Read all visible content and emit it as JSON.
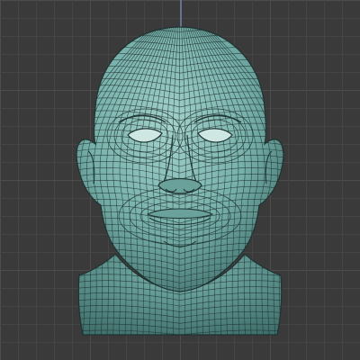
{
  "viewport": {
    "kind": "3d-viewport",
    "object": "wireframe-head-mesh",
    "background_color": "#3a3a3a",
    "grid_minor_color": "#454545",
    "grid_major_color": "#4d4d4d",
    "axis_color": "#6f83a6",
    "mesh_fill_color": "#77b0aa",
    "mesh_shadow_color": "#3f6f6b",
    "mesh_highlight_color": "#a4d2cc",
    "wire_color": "#1f3331"
  }
}
